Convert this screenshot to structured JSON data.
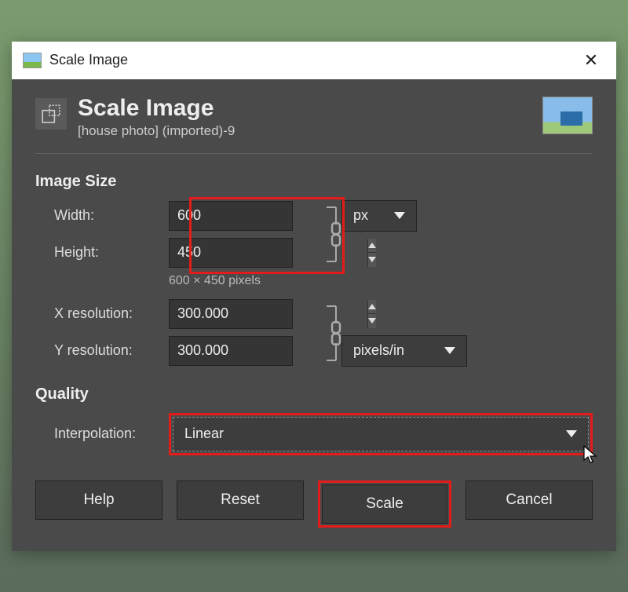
{
  "titlebar": {
    "title": "Scale Image"
  },
  "header": {
    "title": "Scale Image",
    "subtitle": "[house photo] (imported)-9"
  },
  "sections": {
    "image_size": "Image Size",
    "quality": "Quality"
  },
  "labels": {
    "width": "Width:",
    "height": "Height:",
    "xres": "X resolution:",
    "yres": "Y resolution:",
    "interp": "Interpolation:"
  },
  "values": {
    "width": "600",
    "height": "450",
    "xres": "300.000",
    "yres": "300.000",
    "unit": "px",
    "res_unit": "pixels/in",
    "interp": "Linear",
    "hint": "600 × 450 pixels"
  },
  "buttons": {
    "help": "Help",
    "reset": "Reset",
    "scale": "Scale",
    "cancel": "Cancel"
  }
}
